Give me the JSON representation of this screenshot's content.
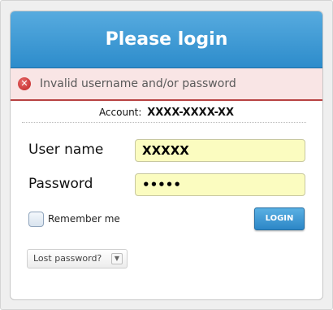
{
  "header": {
    "title": "Please login"
  },
  "error": {
    "icon": "error-x-icon",
    "message": "Invalid username and/or password"
  },
  "account": {
    "label": "Account:",
    "value": "XXXX-XXXX-XX"
  },
  "form": {
    "username_label": "User name",
    "username_value": "XXXXX",
    "password_label": "Password",
    "password_value": "•••••",
    "remember_label": "Remember me",
    "remember_checked": false,
    "login_label": "LOGIN",
    "lost_password_label": "Lost password?",
    "lost_password_icon": "chevron-down-icon"
  },
  "colors": {
    "header_blue": "#3f9ad5",
    "error_bg": "#f9e5e5",
    "error_border": "#b74242",
    "field_bg": "#fbfcc0"
  }
}
